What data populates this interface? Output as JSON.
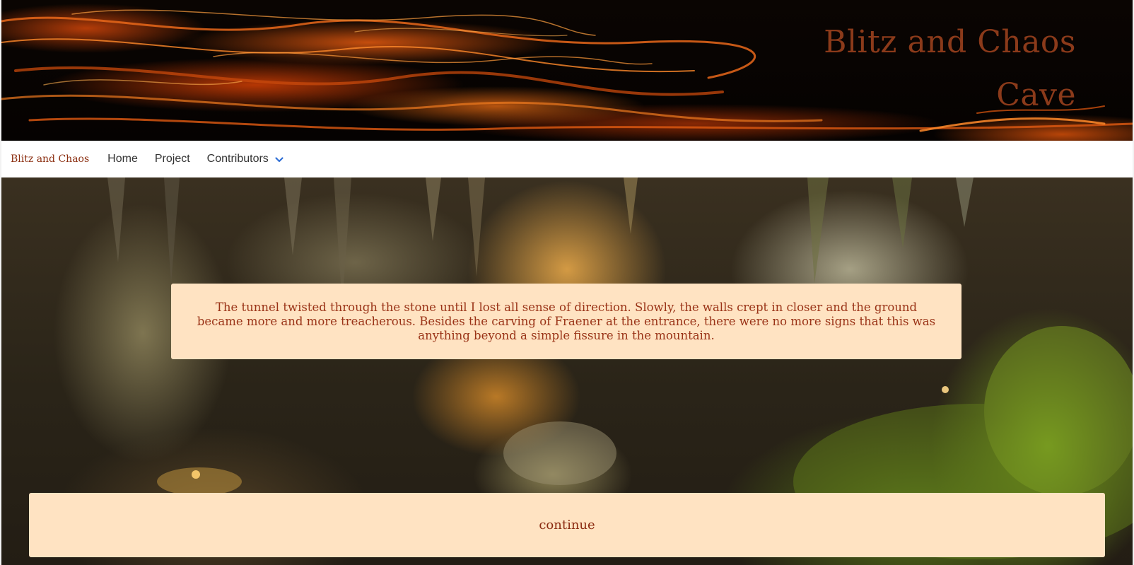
{
  "banner": {
    "title": "Blitz and Chaos Cave"
  },
  "nav": {
    "brand": "Blitz and Chaos",
    "items": [
      {
        "label": "Home"
      },
      {
        "label": "Project"
      },
      {
        "label": "Contributors",
        "has_dropdown": true
      }
    ]
  },
  "story": {
    "text": "The tunnel twisted through the stone until I lost all sense of direction. Slowly, the walls crept in closer and the ground became more and more treacherous. Besides the carving of Fraener at the entrance, there were no more signs that this was anything beyond a simple fissure in the mountain."
  },
  "actions": {
    "continue_label": "continue"
  },
  "colors": {
    "title": "#8b3a1a",
    "panel_bg": "#ffe3c2",
    "text": "#9a3317",
    "chevron": "#2f6fd6"
  },
  "icons": {
    "dropdown": "chevron-down-icon"
  }
}
